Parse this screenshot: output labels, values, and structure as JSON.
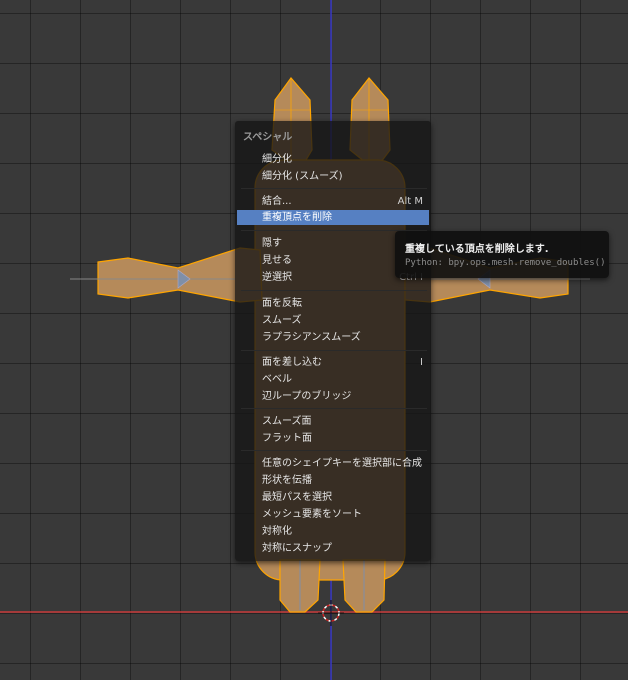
{
  "menu": {
    "title": "スペシャル",
    "items": [
      {
        "label": "細分化",
        "shortcut": ""
      },
      {
        "label": "細分化 (スムーズ)",
        "shortcut": ""
      },
      {
        "label": "結合...",
        "shortcut": "Alt M"
      },
      {
        "label": "重複頂点を削除",
        "shortcut": "",
        "active": true
      },
      {
        "label": "隠す",
        "shortcut": ""
      },
      {
        "label": "見せる",
        "shortcut": ""
      },
      {
        "label": "逆選択",
        "shortcut": "Ctrl I"
      },
      {
        "label": "面を反転",
        "shortcut": ""
      },
      {
        "label": "スムーズ",
        "shortcut": ""
      },
      {
        "label": "ラプラシアンスムーズ",
        "shortcut": ""
      },
      {
        "label": "面を差し込む",
        "shortcut": "I"
      },
      {
        "label": "ベベル",
        "shortcut": ""
      },
      {
        "label": "辺ループのブリッジ",
        "shortcut": ""
      },
      {
        "label": "スムーズ面",
        "shortcut": ""
      },
      {
        "label": "フラット面",
        "shortcut": ""
      },
      {
        "label": "任意のシェイプキーを選択部に合成",
        "shortcut": ""
      },
      {
        "label": "形状を伝播",
        "shortcut": ""
      },
      {
        "label": "最短パスを選択",
        "shortcut": ""
      },
      {
        "label": "メッシュ要素をソート",
        "shortcut": ""
      },
      {
        "label": "対称化",
        "shortcut": ""
      },
      {
        "label": "対称にスナップ",
        "shortcut": ""
      }
    ]
  },
  "tooltip": {
    "title": "重複している頂点を削除します.",
    "python": "Python: bpy.ops.mesh.remove_doubles()"
  },
  "colors": {
    "background": "#393939",
    "mesh_fill": "#b58a5a",
    "selected_edge": "#ffa500",
    "axis_x": "#c83a3a",
    "axis_z": "#3a3ac8",
    "highlight": "#5680c2"
  },
  "icons": [
    "3d-cursor-icon"
  ]
}
